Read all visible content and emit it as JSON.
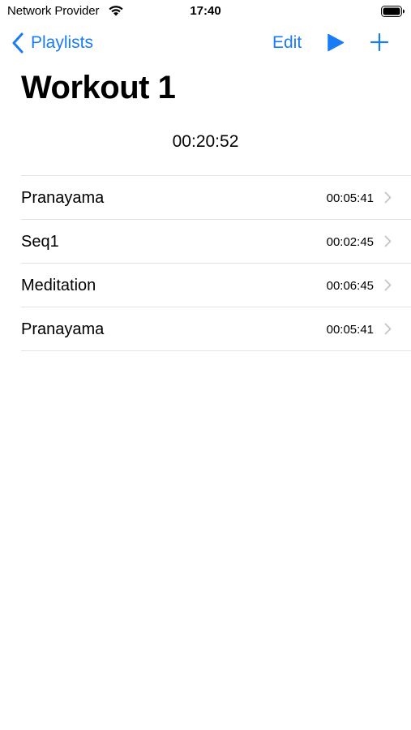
{
  "status_bar": {
    "carrier": "Network Provider",
    "time": "17:40"
  },
  "nav": {
    "back_label": "Playlists",
    "edit_label": "Edit",
    "icons": [
      "chevron-left-icon",
      "play-icon",
      "plus-icon"
    ]
  },
  "page": {
    "title": "Workout 1",
    "total_duration": "00:20:52"
  },
  "items": [
    {
      "title": "Pranayama",
      "duration": "00:05:41"
    },
    {
      "title": "Seq1",
      "duration": "00:02:45"
    },
    {
      "title": "Meditation",
      "duration": "00:06:45"
    },
    {
      "title": "Pranayama",
      "duration": "00:05:41"
    }
  ],
  "colors": {
    "accent": "#1a7cf5",
    "separator": "#e3e3e6",
    "chevron": "#c4c4c7"
  }
}
